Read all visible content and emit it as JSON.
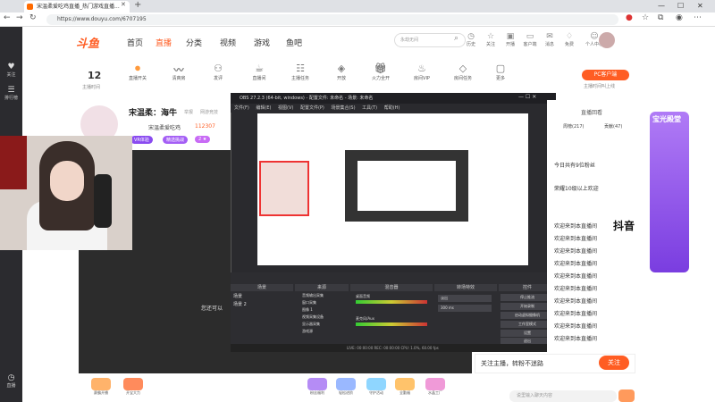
{
  "browser": {
    "tab_title": "宋温柔爱吃鸡直播_热门游戏直播...",
    "url": "https://www.douyu.com/6707195",
    "window_min": "—",
    "window_max": "☐",
    "window_close": "✕"
  },
  "left_toolbar": [
    {
      "icon": "heart-icon",
      "label": "关注"
    },
    {
      "icon": "list-icon",
      "label": "排行榜"
    },
    {
      "icon": "history-icon",
      "label": "直播"
    }
  ],
  "header": {
    "logo": "斗鱼",
    "nav": [
      "首页",
      "直播",
      "分类",
      "视频",
      "游戏",
      "鱼吧"
    ],
    "active_nav": "直播",
    "search_placeholder": "永劫无间",
    "icons": [
      {
        "label": "历史",
        "icon": "clock-icon"
      },
      {
        "label": "关注",
        "icon": "star-icon"
      },
      {
        "label": "开播",
        "icon": "broadcast-icon"
      },
      {
        "label": "客户端",
        "icon": "client-icon"
      },
      {
        "label": "消息",
        "icon": "bell-icon"
      },
      {
        "label": "免费",
        "icon": "gift-icon"
      },
      {
        "label": "个人中心",
        "icon": "user-icon"
      }
    ]
  },
  "toolbar": {
    "level_number": "12",
    "level_label": "主播时间",
    "items": [
      "直播开关",
      "清爽房",
      "发评",
      "直播间",
      "主播任务",
      "开放",
      "火力全开",
      "房间VIP",
      "房间任务",
      "更多"
    ],
    "pc_button": "PC客户端",
    "pc_sub": "主播时间叫上线"
  },
  "room": {
    "title": "宋温柔：海牛",
    "tag1": "举报",
    "tag2": "网游竞技",
    "anchor": "宋温柔爱吃鸡",
    "hot": "112307",
    "badge1": "VR体验",
    "badge2": "精选挑战",
    "badge3": "2 ★"
  },
  "obs": {
    "title": "OBS 27.2.3 (64-bit, windows) - 配置文件: 未命名 - 场景: 未命名",
    "menu": [
      "文件(F)",
      "编辑(E)",
      "视图(V)",
      "配置文件(P)",
      "场景集合(S)",
      "工具(T)",
      "帮助(H)"
    ],
    "docks": [
      "场景",
      "来源",
      "混音器",
      "转场特效",
      "控件"
    ],
    "scenes": [
      "场景",
      "场景 2"
    ],
    "sources": [
      "音频输出采集",
      "窗口采集",
      "图像 1",
      "视频采集设备",
      "显示器采集",
      "游戏源"
    ],
    "mixer": [
      "桌面音频",
      "麦克风/Aux"
    ],
    "transition": "淡出",
    "duration": "300 ms",
    "controls": [
      "停止推流",
      "开始录制",
      "启动虚拟摄像机",
      "工作室模式",
      "设置",
      "退出"
    ],
    "status": "LIVE: 00:00:00   REC: 00:00:00   CPU: 1.0%, 60.00 fps"
  },
  "right_panel": {
    "tabs": [
      "周榜(217)",
      "贡献(47)"
    ],
    "hot_label": "直播回看",
    "chat": [
      "今日共有9位粉丝",
      "荣耀10级以上欢迎",
      "欢迎来到本直播间",
      "欢迎来到本直播间",
      "欢迎来到本直播间",
      "欢迎来到本直播间",
      "欢迎来到本直播间",
      "欢迎来到本直播间",
      "欢迎来到本直播间",
      "欢迎来到本直播间",
      "欢迎来到本直播间",
      "欢迎来到本直播间"
    ],
    "ad_title": "宝光殿堂",
    "tiktok": "抖音",
    "follow_text": "关注主播，转粉不迷路",
    "follow_button": "关注",
    "input_placeholder": "说里输入聊天内容",
    "subtitle_text": "您还可以"
  },
  "bottom_gifts": [
    "赛霸开播",
    "开宝大力",
    "粉丝福利",
    "轻松进阶",
    "守护活动",
    "全勤福",
    "水晶工厂"
  ],
  "colors": {
    "brand": "#ff5d23",
    "obs_bg": "#2a2a2e",
    "ad_purple": "#7a3de0"
  }
}
